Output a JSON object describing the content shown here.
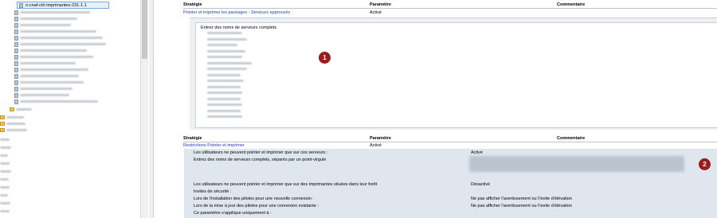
{
  "tree": {
    "selected_item": "o-cnaf-ctrl-imprimantes-231-1.1"
  },
  "section1": {
    "headers": {
      "strategie": "Stratégie",
      "parametre": "Paramètre",
      "commentaire": "Commentaire"
    },
    "policy_link": "Pointer et imprimer les packages - Serveurs approuvés",
    "policy_value": "Activé",
    "list_title": "Entrez des noms de serveurs complets",
    "badge": "1"
  },
  "section2": {
    "headers": {
      "strategie": "Stratégie",
      "parametre": "Paramètre",
      "commentaire": "Commentaire"
    },
    "policy_link": "Restrictions Pointer et imprimer",
    "policy_value": "Activé",
    "rows": [
      {
        "label": "Les utilisateurs ne peuvent pointer et imprimer que sur ces serveurs :",
        "value": "Activé"
      },
      {
        "label": "Entrez des noms de serveurs complets, séparés par un point-virgule",
        "value": ""
      },
      {
        "label": "Les utilisateurs ne peuvent pointer et imprimer que sur des imprimantes situées dans leur forêt",
        "value": "Désactivé"
      },
      {
        "label": "Invites de sécurité :",
        "value": ""
      },
      {
        "label": "Lors de l'installation des pilotes pour une nouvelle connexion :",
        "value": "Ne pas afficher l'avertissement ou l'invite d'élévation"
      },
      {
        "label": "Lors de la mise à jour des pilotes pour une connexion existante :",
        "value": "Ne pas afficher l'avertissement ou l'invite d'élévation"
      },
      {
        "label": "Ce paramètre s'applique uniquement à :",
        "value": ""
      }
    ],
    "badge": "2"
  }
}
